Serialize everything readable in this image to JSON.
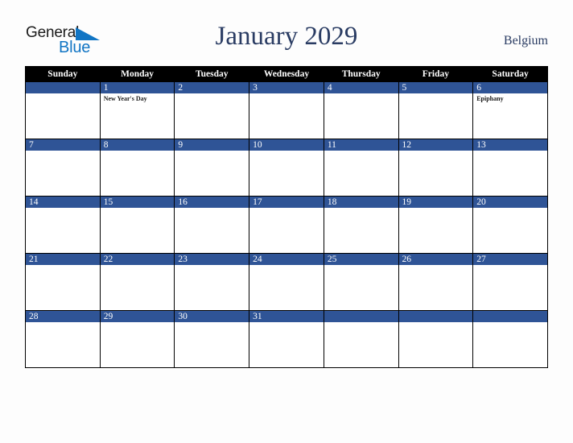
{
  "brand": {
    "line1": "General",
    "line2": "Blue",
    "triangle_color": "#1175c4",
    "line1_color": "#1b1b1b",
    "line2_color": "#1175c4"
  },
  "header": {
    "title": "January 2029",
    "country": "Belgium",
    "title_color": "#2a3c63"
  },
  "calendar": {
    "weekday_headers": [
      "Sunday",
      "Monday",
      "Tuesday",
      "Wednesday",
      "Thursday",
      "Friday",
      "Saturday"
    ],
    "header_bg": "#000000",
    "header_text_color": "#ffffff",
    "daynum_bg": "#2f5496",
    "daynum_text_color": "#ffffff",
    "cell_bg": "#ffffff",
    "weeks": [
      [
        {
          "day": "",
          "events": []
        },
        {
          "day": "1",
          "events": [
            "New Year's Day"
          ]
        },
        {
          "day": "2",
          "events": []
        },
        {
          "day": "3",
          "events": []
        },
        {
          "day": "4",
          "events": []
        },
        {
          "day": "5",
          "events": []
        },
        {
          "day": "6",
          "events": [
            "Epiphany"
          ]
        }
      ],
      [
        {
          "day": "7",
          "events": []
        },
        {
          "day": "8",
          "events": []
        },
        {
          "day": "9",
          "events": []
        },
        {
          "day": "10",
          "events": []
        },
        {
          "day": "11",
          "events": []
        },
        {
          "day": "12",
          "events": []
        },
        {
          "day": "13",
          "events": []
        }
      ],
      [
        {
          "day": "14",
          "events": []
        },
        {
          "day": "15",
          "events": []
        },
        {
          "day": "16",
          "events": []
        },
        {
          "day": "17",
          "events": []
        },
        {
          "day": "18",
          "events": []
        },
        {
          "day": "19",
          "events": []
        },
        {
          "day": "20",
          "events": []
        }
      ],
      [
        {
          "day": "21",
          "events": []
        },
        {
          "day": "22",
          "events": []
        },
        {
          "day": "23",
          "events": []
        },
        {
          "day": "24",
          "events": []
        },
        {
          "day": "25",
          "events": []
        },
        {
          "day": "26",
          "events": []
        },
        {
          "day": "27",
          "events": []
        }
      ],
      [
        {
          "day": "28",
          "events": []
        },
        {
          "day": "29",
          "events": []
        },
        {
          "day": "30",
          "events": []
        },
        {
          "day": "31",
          "events": []
        },
        {
          "day": "",
          "events": []
        },
        {
          "day": "",
          "events": []
        },
        {
          "day": "",
          "events": []
        }
      ]
    ]
  }
}
